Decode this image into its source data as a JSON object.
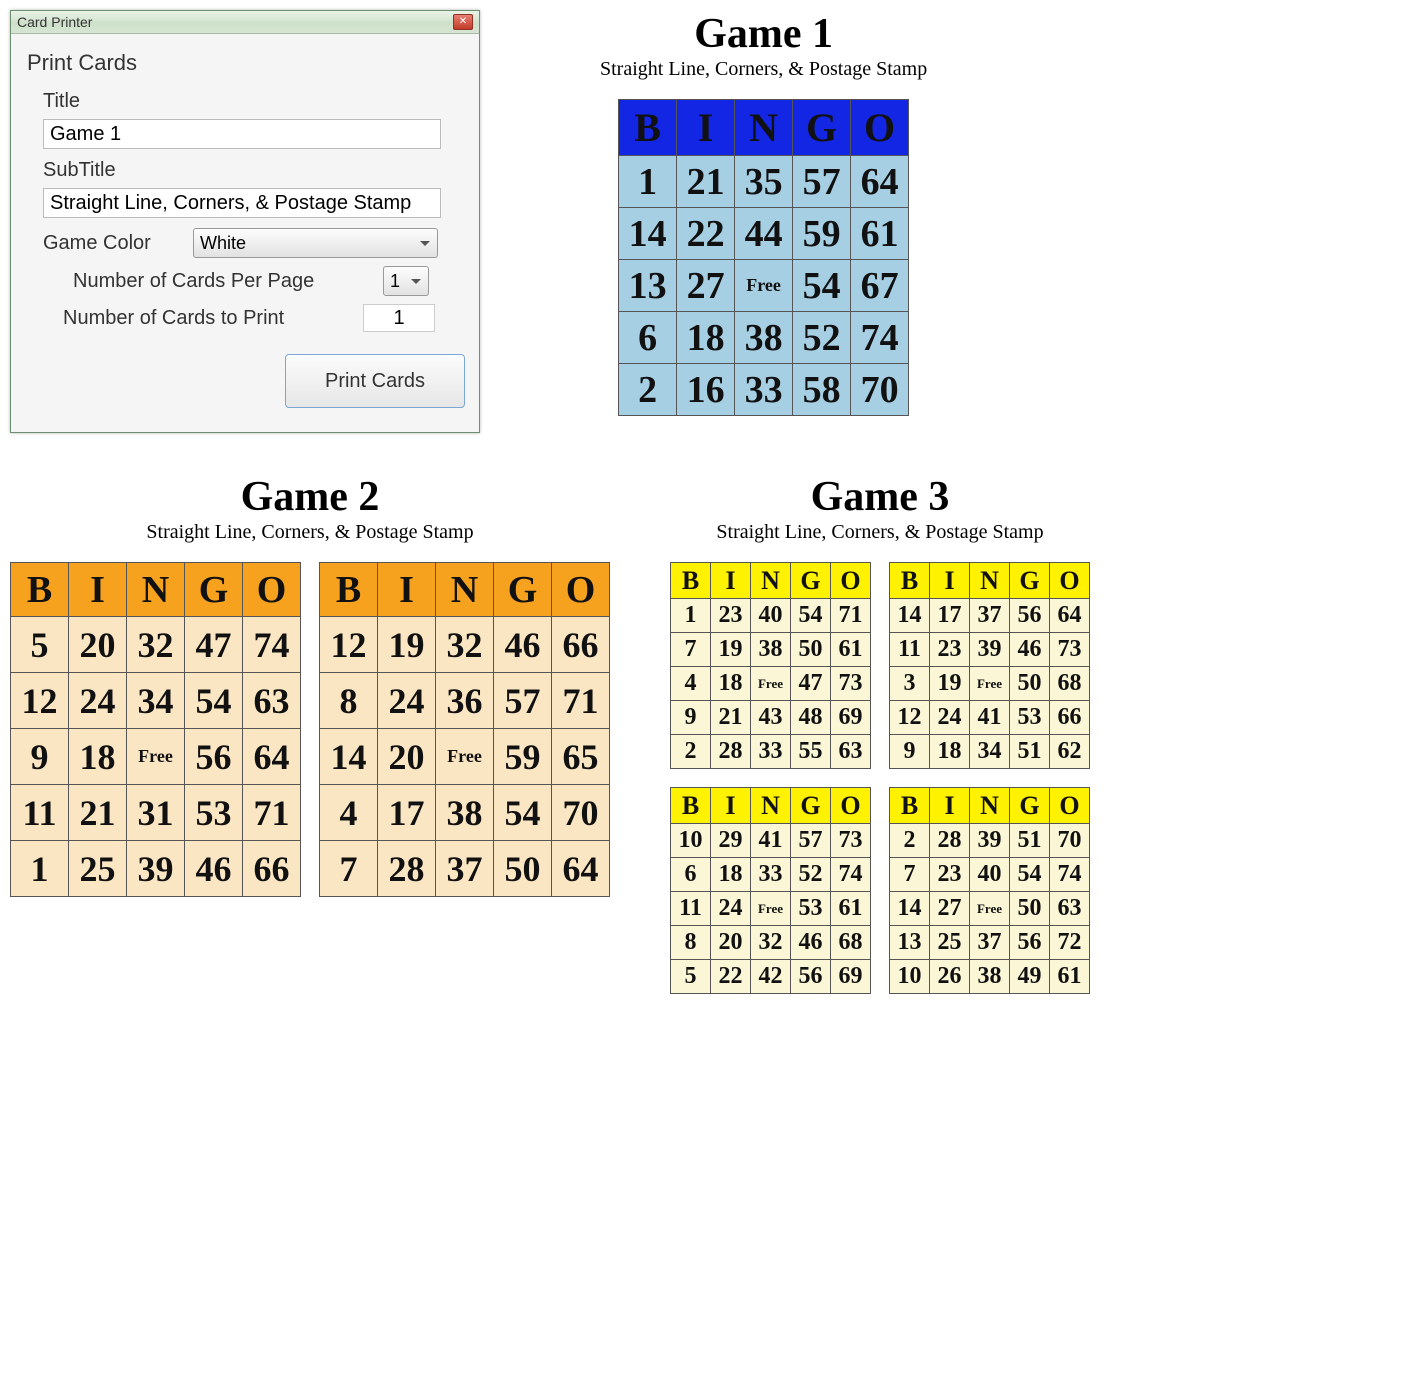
{
  "dialog": {
    "window_title": "Card Printer",
    "group_title": "Print Cards",
    "title_label": "Title",
    "title_value": "Game 1",
    "subtitle_label": "SubTitle",
    "subtitle_value": "Straight Line, Corners, & Postage Stamp",
    "color_label": "Game Color",
    "color_value": "White",
    "cards_per_page_label": "Number of Cards Per Page",
    "cards_per_page_value": "1",
    "cards_to_print_label": "Number of Cards to Print",
    "cards_to_print_value": "1",
    "print_button": "Print Cards"
  },
  "bingo_header": [
    "B",
    "I",
    "N",
    "G",
    "O"
  ],
  "game1": {
    "title": "Game 1",
    "subtitle": "Straight Line, Corners, & Postage Stamp",
    "cards": [
      [
        [
          "1",
          "21",
          "35",
          "57",
          "64"
        ],
        [
          "14",
          "22",
          "44",
          "59",
          "61"
        ],
        [
          "13",
          "27",
          "Free",
          "54",
          "67"
        ],
        [
          "6",
          "18",
          "38",
          "52",
          "74"
        ],
        [
          "2",
          "16",
          "33",
          "58",
          "70"
        ]
      ]
    ]
  },
  "game2": {
    "title": "Game 2",
    "subtitle": "Straight Line, Corners, & Postage Stamp",
    "cards": [
      [
        [
          "5",
          "20",
          "32",
          "47",
          "74"
        ],
        [
          "12",
          "24",
          "34",
          "54",
          "63"
        ],
        [
          "9",
          "18",
          "Free",
          "56",
          "64"
        ],
        [
          "11",
          "21",
          "31",
          "53",
          "71"
        ],
        [
          "1",
          "25",
          "39",
          "46",
          "66"
        ]
      ],
      [
        [
          "12",
          "19",
          "32",
          "46",
          "66"
        ],
        [
          "8",
          "24",
          "36",
          "57",
          "71"
        ],
        [
          "14",
          "20",
          "Free",
          "59",
          "65"
        ],
        [
          "4",
          "17",
          "38",
          "54",
          "70"
        ],
        [
          "7",
          "28",
          "37",
          "50",
          "64"
        ]
      ]
    ]
  },
  "game3": {
    "title": "Game 3",
    "subtitle": "Straight Line, Corners, & Postage Stamp",
    "cards": [
      [
        [
          "1",
          "23",
          "40",
          "54",
          "71"
        ],
        [
          "7",
          "19",
          "38",
          "50",
          "61"
        ],
        [
          "4",
          "18",
          "Free",
          "47",
          "73"
        ],
        [
          "9",
          "21",
          "43",
          "48",
          "69"
        ],
        [
          "2",
          "28",
          "33",
          "55",
          "63"
        ]
      ],
      [
        [
          "14",
          "17",
          "37",
          "56",
          "64"
        ],
        [
          "11",
          "23",
          "39",
          "46",
          "73"
        ],
        [
          "3",
          "19",
          "Free",
          "50",
          "68"
        ],
        [
          "12",
          "24",
          "41",
          "53",
          "66"
        ],
        [
          "9",
          "18",
          "34",
          "51",
          "62"
        ]
      ],
      [
        [
          "10",
          "29",
          "41",
          "57",
          "73"
        ],
        [
          "6",
          "18",
          "33",
          "52",
          "74"
        ],
        [
          "11",
          "24",
          "Free",
          "53",
          "61"
        ],
        [
          "8",
          "20",
          "32",
          "46",
          "68"
        ],
        [
          "5",
          "22",
          "42",
          "56",
          "69"
        ]
      ],
      [
        [
          "2",
          "28",
          "39",
          "51",
          "70"
        ],
        [
          "7",
          "23",
          "40",
          "54",
          "74"
        ],
        [
          "14",
          "27",
          "Free",
          "50",
          "63"
        ],
        [
          "13",
          "25",
          "37",
          "56",
          "72"
        ],
        [
          "10",
          "26",
          "38",
          "49",
          "61"
        ]
      ]
    ]
  }
}
